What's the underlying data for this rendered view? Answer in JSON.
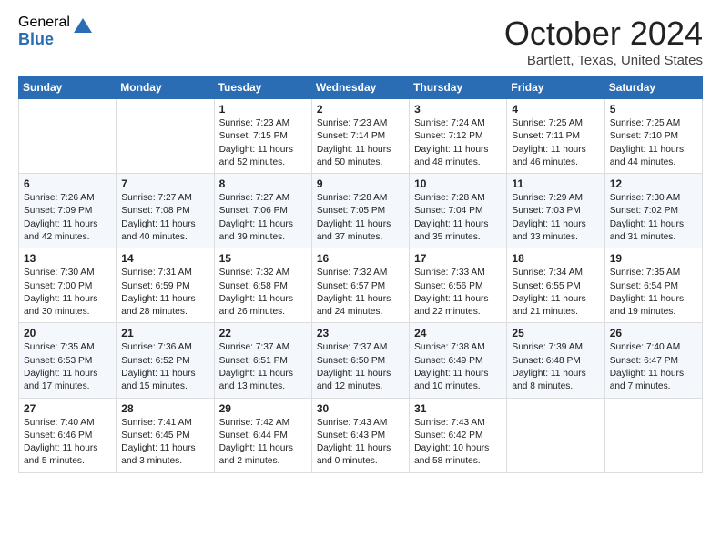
{
  "logo": {
    "general": "General",
    "blue": "Blue"
  },
  "header": {
    "month": "October 2024",
    "location": "Bartlett, Texas, United States"
  },
  "days_of_week": [
    "Sunday",
    "Monday",
    "Tuesday",
    "Wednesday",
    "Thursday",
    "Friday",
    "Saturday"
  ],
  "weeks": [
    [
      {
        "day": "",
        "sunrise": "",
        "sunset": "",
        "daylight": ""
      },
      {
        "day": "",
        "sunrise": "",
        "sunset": "",
        "daylight": ""
      },
      {
        "day": "1",
        "sunrise": "Sunrise: 7:23 AM",
        "sunset": "Sunset: 7:15 PM",
        "daylight": "Daylight: 11 hours and 52 minutes."
      },
      {
        "day": "2",
        "sunrise": "Sunrise: 7:23 AM",
        "sunset": "Sunset: 7:14 PM",
        "daylight": "Daylight: 11 hours and 50 minutes."
      },
      {
        "day": "3",
        "sunrise": "Sunrise: 7:24 AM",
        "sunset": "Sunset: 7:12 PM",
        "daylight": "Daylight: 11 hours and 48 minutes."
      },
      {
        "day": "4",
        "sunrise": "Sunrise: 7:25 AM",
        "sunset": "Sunset: 7:11 PM",
        "daylight": "Daylight: 11 hours and 46 minutes."
      },
      {
        "day": "5",
        "sunrise": "Sunrise: 7:25 AM",
        "sunset": "Sunset: 7:10 PM",
        "daylight": "Daylight: 11 hours and 44 minutes."
      }
    ],
    [
      {
        "day": "6",
        "sunrise": "Sunrise: 7:26 AM",
        "sunset": "Sunset: 7:09 PM",
        "daylight": "Daylight: 11 hours and 42 minutes."
      },
      {
        "day": "7",
        "sunrise": "Sunrise: 7:27 AM",
        "sunset": "Sunset: 7:08 PM",
        "daylight": "Daylight: 11 hours and 40 minutes."
      },
      {
        "day": "8",
        "sunrise": "Sunrise: 7:27 AM",
        "sunset": "Sunset: 7:06 PM",
        "daylight": "Daylight: 11 hours and 39 minutes."
      },
      {
        "day": "9",
        "sunrise": "Sunrise: 7:28 AM",
        "sunset": "Sunset: 7:05 PM",
        "daylight": "Daylight: 11 hours and 37 minutes."
      },
      {
        "day": "10",
        "sunrise": "Sunrise: 7:28 AM",
        "sunset": "Sunset: 7:04 PM",
        "daylight": "Daylight: 11 hours and 35 minutes."
      },
      {
        "day": "11",
        "sunrise": "Sunrise: 7:29 AM",
        "sunset": "Sunset: 7:03 PM",
        "daylight": "Daylight: 11 hours and 33 minutes."
      },
      {
        "day": "12",
        "sunrise": "Sunrise: 7:30 AM",
        "sunset": "Sunset: 7:02 PM",
        "daylight": "Daylight: 11 hours and 31 minutes."
      }
    ],
    [
      {
        "day": "13",
        "sunrise": "Sunrise: 7:30 AM",
        "sunset": "Sunset: 7:00 PM",
        "daylight": "Daylight: 11 hours and 30 minutes."
      },
      {
        "day": "14",
        "sunrise": "Sunrise: 7:31 AM",
        "sunset": "Sunset: 6:59 PM",
        "daylight": "Daylight: 11 hours and 28 minutes."
      },
      {
        "day": "15",
        "sunrise": "Sunrise: 7:32 AM",
        "sunset": "Sunset: 6:58 PM",
        "daylight": "Daylight: 11 hours and 26 minutes."
      },
      {
        "day": "16",
        "sunrise": "Sunrise: 7:32 AM",
        "sunset": "Sunset: 6:57 PM",
        "daylight": "Daylight: 11 hours and 24 minutes."
      },
      {
        "day": "17",
        "sunrise": "Sunrise: 7:33 AM",
        "sunset": "Sunset: 6:56 PM",
        "daylight": "Daylight: 11 hours and 22 minutes."
      },
      {
        "day": "18",
        "sunrise": "Sunrise: 7:34 AM",
        "sunset": "Sunset: 6:55 PM",
        "daylight": "Daylight: 11 hours and 21 minutes."
      },
      {
        "day": "19",
        "sunrise": "Sunrise: 7:35 AM",
        "sunset": "Sunset: 6:54 PM",
        "daylight": "Daylight: 11 hours and 19 minutes."
      }
    ],
    [
      {
        "day": "20",
        "sunrise": "Sunrise: 7:35 AM",
        "sunset": "Sunset: 6:53 PM",
        "daylight": "Daylight: 11 hours and 17 minutes."
      },
      {
        "day": "21",
        "sunrise": "Sunrise: 7:36 AM",
        "sunset": "Sunset: 6:52 PM",
        "daylight": "Daylight: 11 hours and 15 minutes."
      },
      {
        "day": "22",
        "sunrise": "Sunrise: 7:37 AM",
        "sunset": "Sunset: 6:51 PM",
        "daylight": "Daylight: 11 hours and 13 minutes."
      },
      {
        "day": "23",
        "sunrise": "Sunrise: 7:37 AM",
        "sunset": "Sunset: 6:50 PM",
        "daylight": "Daylight: 11 hours and 12 minutes."
      },
      {
        "day": "24",
        "sunrise": "Sunrise: 7:38 AM",
        "sunset": "Sunset: 6:49 PM",
        "daylight": "Daylight: 11 hours and 10 minutes."
      },
      {
        "day": "25",
        "sunrise": "Sunrise: 7:39 AM",
        "sunset": "Sunset: 6:48 PM",
        "daylight": "Daylight: 11 hours and 8 minutes."
      },
      {
        "day": "26",
        "sunrise": "Sunrise: 7:40 AM",
        "sunset": "Sunset: 6:47 PM",
        "daylight": "Daylight: 11 hours and 7 minutes."
      }
    ],
    [
      {
        "day": "27",
        "sunrise": "Sunrise: 7:40 AM",
        "sunset": "Sunset: 6:46 PM",
        "daylight": "Daylight: 11 hours and 5 minutes."
      },
      {
        "day": "28",
        "sunrise": "Sunrise: 7:41 AM",
        "sunset": "Sunset: 6:45 PM",
        "daylight": "Daylight: 11 hours and 3 minutes."
      },
      {
        "day": "29",
        "sunrise": "Sunrise: 7:42 AM",
        "sunset": "Sunset: 6:44 PM",
        "daylight": "Daylight: 11 hours and 2 minutes."
      },
      {
        "day": "30",
        "sunrise": "Sunrise: 7:43 AM",
        "sunset": "Sunset: 6:43 PM",
        "daylight": "Daylight: 11 hours and 0 minutes."
      },
      {
        "day": "31",
        "sunrise": "Sunrise: 7:43 AM",
        "sunset": "Sunset: 6:42 PM",
        "daylight": "Daylight: 10 hours and 58 minutes."
      },
      {
        "day": "",
        "sunrise": "",
        "sunset": "",
        "daylight": ""
      },
      {
        "day": "",
        "sunrise": "",
        "sunset": "",
        "daylight": ""
      }
    ]
  ]
}
